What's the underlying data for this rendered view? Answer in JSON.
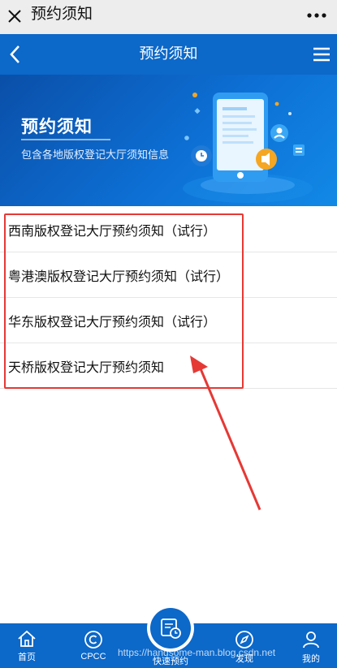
{
  "wechat_bar": {
    "title": "预约须知"
  },
  "nav": {
    "title": "预约须知"
  },
  "banner": {
    "title": "预约须知",
    "subtitle": "包含各地版权登记大厅须知信息"
  },
  "notices": [
    {
      "label": "西南版权登记大厅预约须知（试行）"
    },
    {
      "label": "粤港澳版权登记大厅预约须知（试行）"
    },
    {
      "label": "华东版权登记大厅预约须知（试行）"
    },
    {
      "label": "天桥版权登记大厅预约须知"
    }
  ],
  "tabs": [
    {
      "label": "首页",
      "icon": "home-icon"
    },
    {
      "label": "CPCC",
      "icon": "copyright-icon"
    },
    {
      "label": "快速预约",
      "icon": "calendar-clock-icon"
    },
    {
      "label": "发现",
      "icon": "compass-icon"
    },
    {
      "label": "我的",
      "icon": "user-icon"
    }
  ],
  "watermark": "https://handsome-man.blog.csdn.net",
  "colors": {
    "brand": "#0c68c9",
    "highlight": "#e53935"
  }
}
